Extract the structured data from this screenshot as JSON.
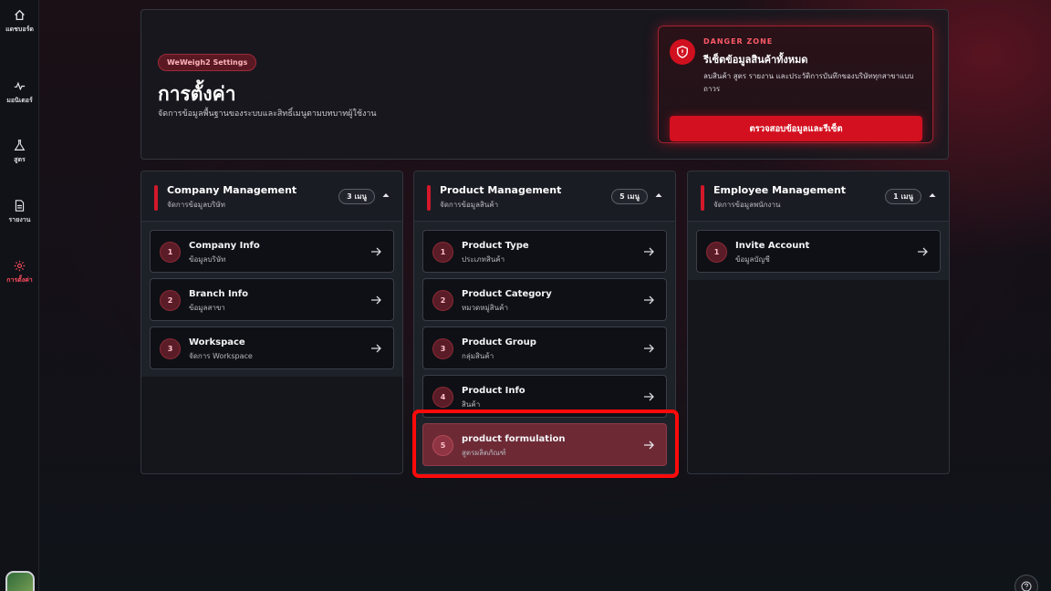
{
  "sidebar": {
    "items": [
      {
        "label": "แดชบอร์ด",
        "icon": "home-icon"
      },
      {
        "label": "มอนิเตอร์",
        "icon": "pulse-icon"
      },
      {
        "label": "สูตร",
        "icon": "flask-icon"
      },
      {
        "label": "รายงาน",
        "icon": "document-icon"
      },
      {
        "label": "การตั้งค่า",
        "icon": "gear-icon",
        "active": true
      }
    ]
  },
  "header": {
    "pill": "WeWeigh2 Settings",
    "title": "การตั้งค่า",
    "subtitle": "จัดการข้อมูลพื้นฐานของระบบและสิทธิ์เมนูตามบทบาทผู้ใช้งาน"
  },
  "danger": {
    "eyebrow": "DANGER ZONE",
    "title": "รีเซ็ตข้อมูลสินค้าทั้งหมด",
    "description": "ลบสินค้า สูตร รายงาน และประวัติการบันทึกของบริษัททุกสาขาแบบถาวร",
    "button": "ตรวจสอบข้อมูลและรีเซ็ต",
    "accent": "#d3101f"
  },
  "columns": [
    {
      "title": "Company Management",
      "subtitle": "จัดการข้อมูลบริษัท",
      "count": "3 เมนู",
      "items": [
        {
          "num": "1",
          "title": "Company Info",
          "sub": "ข้อมูลบริษัท"
        },
        {
          "num": "2",
          "title": "Branch Info",
          "sub": "ข้อมูลสาขา"
        },
        {
          "num": "3",
          "title": "Workspace",
          "sub": "จัดการ Workspace"
        }
      ]
    },
    {
      "title": "Product Management",
      "subtitle": "จัดการข้อมูลสินค้า",
      "count": "5 เมนู",
      "items": [
        {
          "num": "1",
          "title": "Product Type",
          "sub": "ประเภทสินค้า"
        },
        {
          "num": "2",
          "title": "Product Category",
          "sub": "หมวดหมู่สินค้า"
        },
        {
          "num": "3",
          "title": "Product Group",
          "sub": "กลุ่มสินค้า"
        },
        {
          "num": "4",
          "title": "Product Info",
          "sub": "สินค้า"
        },
        {
          "num": "5",
          "title": "product formulation",
          "sub": "สูตรผลิตภัณฑ์"
        }
      ]
    },
    {
      "title": "Employee Management",
      "subtitle": "จัดการข้อมูลพนักงาน",
      "count": "1 เมนู",
      "items": [
        {
          "num": "1",
          "title": "Invite Account",
          "sub": "ข้อมูลบัญชี"
        }
      ]
    }
  ]
}
